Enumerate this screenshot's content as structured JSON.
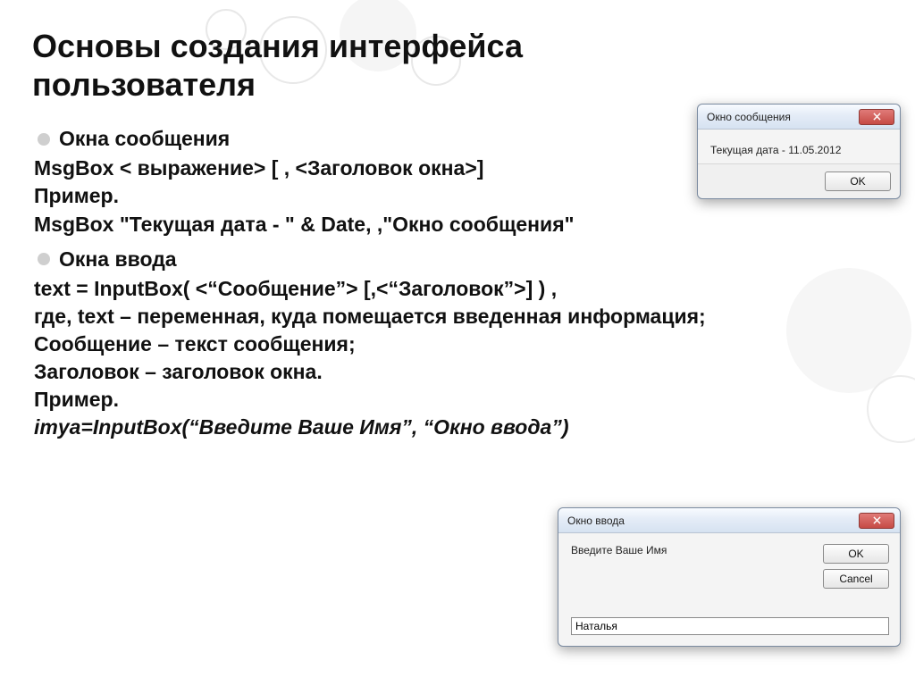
{
  "title": "Основы создания интерфейса пользователя",
  "section1": {
    "heading": "Окна сообщения",
    "line1": "MsgBox < выражение> [ , <Заголовок окна>]",
    "line2": "Пример.",
    "line3": "MsgBox \"Текущая дата - \" & Date, ,\"Окно сообщения\""
  },
  "section2": {
    "heading": "Окна ввода",
    "line1": "text = InputBox( <“Сообщение”> [,<“Заголовок”>] ) ,",
    "line2": "где, text – переменная, куда помещается введенная информация;",
    "line3": "Сообщение – текст сообщения;",
    "line4": "Заголовок – заголовок окна.",
    "line5": "Пример.",
    "line6": "imya=InputBox(“Введите Ваше Имя”, “Окно ввода”)"
  },
  "msgbox": {
    "title": "Окно сообщения",
    "body": "Текущая дата - 11.05.2012",
    "ok": "OK"
  },
  "inputbox": {
    "title": "Окно ввода",
    "prompt": "Введите Ваше Имя",
    "ok": "OK",
    "cancel": "Cancel",
    "value": "Наталья"
  }
}
